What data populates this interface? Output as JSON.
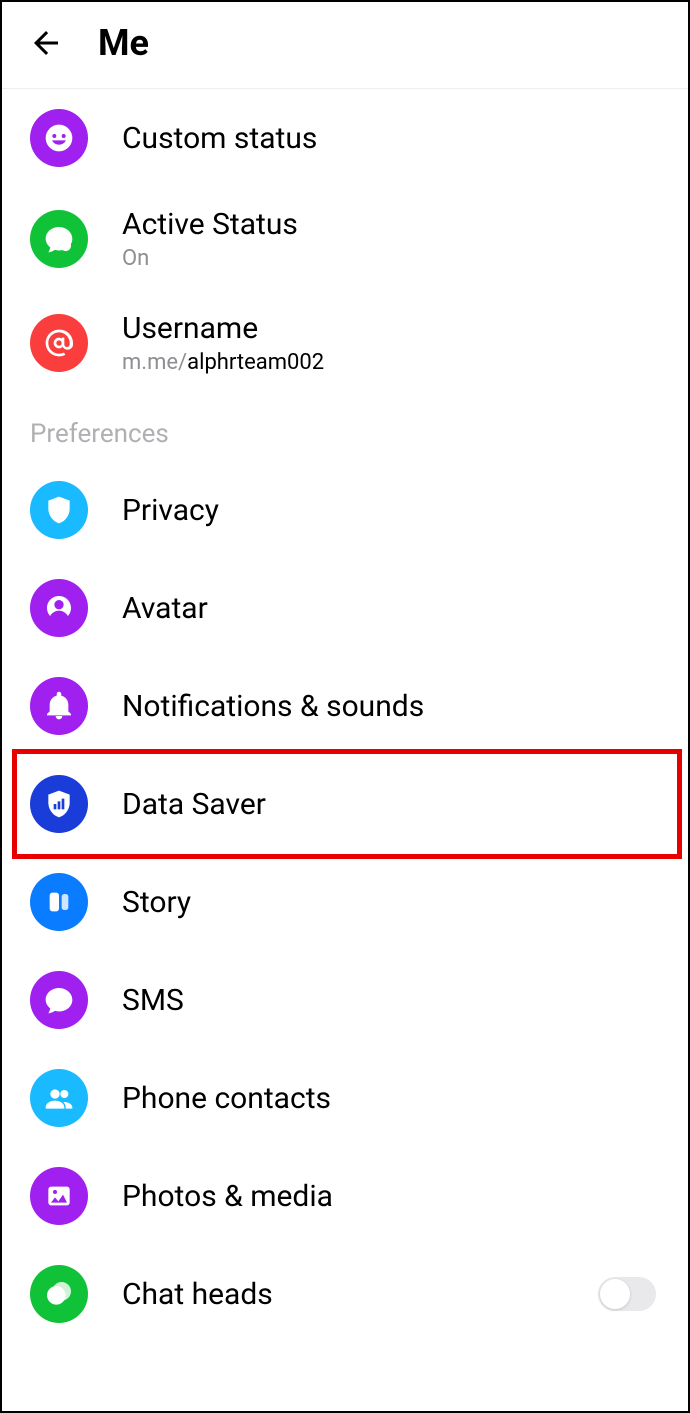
{
  "header": {
    "title": "Me"
  },
  "items": {
    "customStatus": {
      "label": "Custom status",
      "color": "#a020f0"
    },
    "activeStatus": {
      "label": "Active Status",
      "sub": "On",
      "color": "#10c237"
    },
    "username": {
      "label": "Username",
      "subPrefix": "m.me/",
      "subValue": "alphrteam002",
      "color": "#fa3e3e"
    }
  },
  "sectionPreferences": "Preferences",
  "prefs": {
    "privacy": {
      "label": "Privacy",
      "color": "#19baff"
    },
    "avatar": {
      "label": "Avatar",
      "color": "#a020f0"
    },
    "notifications": {
      "label": "Notifications & sounds",
      "color": "#a020f0"
    },
    "dataSaver": {
      "label": "Data Saver",
      "color": "#1a3dd9"
    },
    "story": {
      "label": "Story",
      "color": "#0a7cff"
    },
    "sms": {
      "label": "SMS",
      "color": "#a020f0"
    },
    "phoneContacts": {
      "label": "Phone contacts",
      "color": "#19baff"
    },
    "photosMedia": {
      "label": "Photos & media",
      "color": "#a020f0"
    },
    "chatHeads": {
      "label": "Chat heads",
      "color": "#10c237",
      "toggle": false
    }
  },
  "highlight": "dataSaver"
}
